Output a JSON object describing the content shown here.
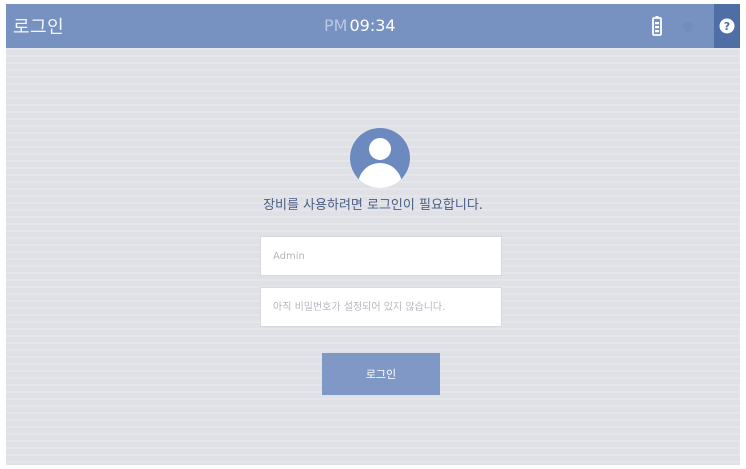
{
  "header": {
    "title": "로그인",
    "time_prefix": "PM",
    "time": "09:34",
    "help_icon": "question-icon"
  },
  "login": {
    "prompt": "장비를 사용하려면 로그인이 필요합니다.",
    "username_placeholder": "Admin",
    "password_placeholder": "아직 비밀번호가 설정되어 있지 않습니다.",
    "button_label": "로그인"
  },
  "colors": {
    "header_bg": "#7792c1",
    "help_bg": "#4f6ea6",
    "page_bg": "#e0e1e6",
    "avatar": "#6c8ac0",
    "button": "#7f98c6"
  }
}
